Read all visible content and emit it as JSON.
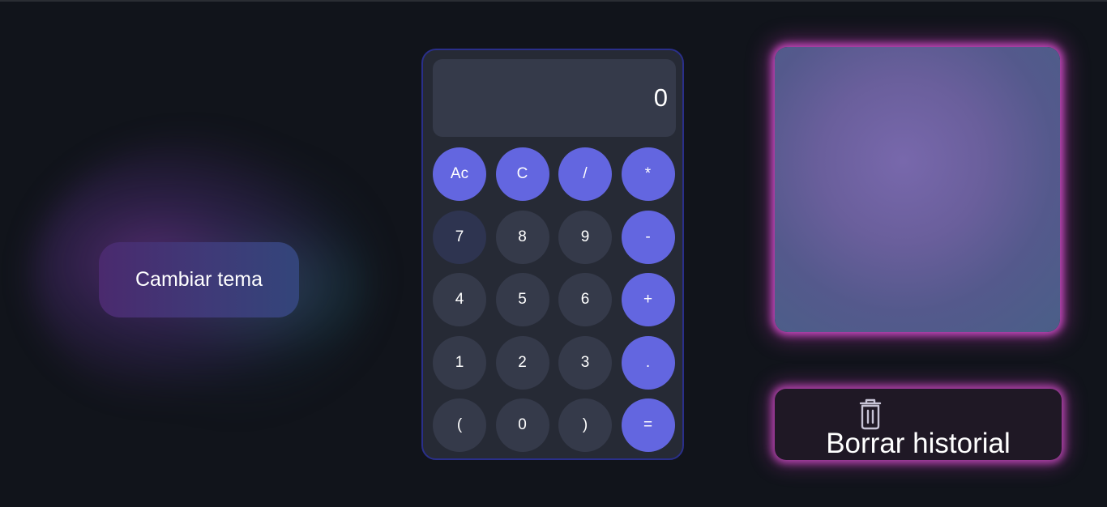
{
  "theme_button": {
    "label": "Cambiar tema"
  },
  "calculator": {
    "display_value": "0",
    "keys": [
      {
        "label": "Ac",
        "kind": "op"
      },
      {
        "label": "C",
        "kind": "op"
      },
      {
        "label": "/",
        "kind": "op"
      },
      {
        "label": "*",
        "kind": "op"
      },
      {
        "label": "7",
        "kind": "num-hover"
      },
      {
        "label": "8",
        "kind": "num"
      },
      {
        "label": "9",
        "kind": "num"
      },
      {
        "label": "-",
        "kind": "op"
      },
      {
        "label": "4",
        "kind": "num"
      },
      {
        "label": "5",
        "kind": "num"
      },
      {
        "label": "6",
        "kind": "num"
      },
      {
        "label": "+",
        "kind": "op"
      },
      {
        "label": "1",
        "kind": "num"
      },
      {
        "label": "2",
        "kind": "num"
      },
      {
        "label": "3",
        "kind": "num"
      },
      {
        "label": ".",
        "kind": "op"
      },
      {
        "label": "(",
        "kind": "num"
      },
      {
        "label": "0",
        "kind": "num"
      },
      {
        "label": ")",
        "kind": "num"
      },
      {
        "label": "=",
        "kind": "op"
      }
    ]
  },
  "history": {
    "entries": []
  },
  "clear_history_button": {
    "label": "Borrar historial",
    "icon": "trash-icon"
  },
  "colors": {
    "background": "#11141b",
    "accent": "#6366e0",
    "key": "#353a4a",
    "glow": "#dc50d2"
  }
}
